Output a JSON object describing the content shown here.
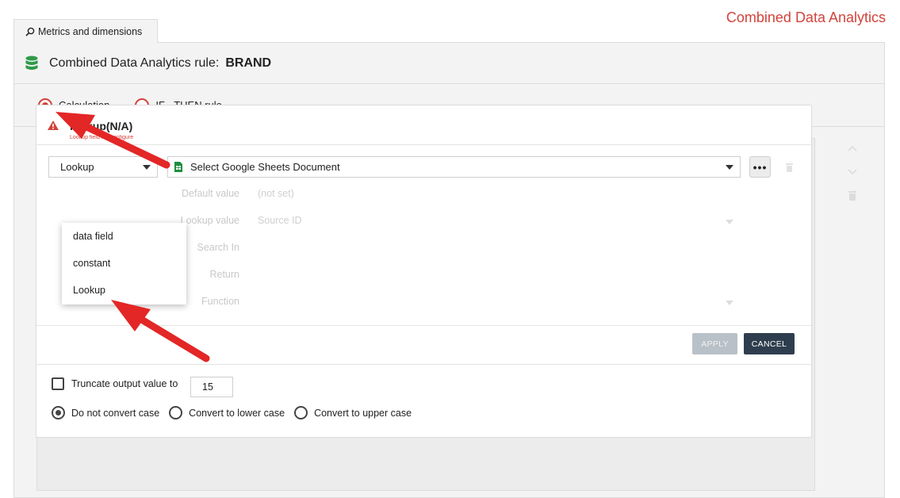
{
  "app_title": "Combined Data Analytics",
  "tab": {
    "label": "Metrics and dimensions",
    "icon": "search-icon"
  },
  "rule": {
    "label": "Combined Data Analytics rule:",
    "value": "BRAND"
  },
  "modes": [
    {
      "label": "Calculation",
      "selected": true
    },
    {
      "label": "IF - THEN rule",
      "selected": false
    }
  ],
  "card": {
    "title": "lookup(N/A)",
    "error": "Lookup field not configured",
    "type_select": {
      "value": "Lookup"
    },
    "doc_select": {
      "value": "Select Google Sheets Document"
    },
    "more_label": "•••",
    "fields": [
      {
        "label": "Default value",
        "value": "(not set)"
      },
      {
        "label": "Lookup value",
        "value": "Source ID"
      },
      {
        "label": "Search In",
        "value": ""
      },
      {
        "label": "Return",
        "value": ""
      },
      {
        "label": "Function",
        "value": ""
      }
    ],
    "dropdown_options": [
      "data field",
      "constant",
      "Lookup"
    ],
    "apply_label": "APPLY",
    "cancel_label": "CANCEL"
  },
  "truncate": {
    "label": "Truncate output value to",
    "value": "15",
    "checked": false
  },
  "case_options": [
    {
      "label": "Do not convert case",
      "selected": true
    },
    {
      "label": "Convert to lower case",
      "selected": false
    },
    {
      "label": "Convert to upper case",
      "selected": false
    }
  ],
  "colors": {
    "accent": "#d2433b",
    "dark_button": "#2f3e4e",
    "sheets_green": "#1e8e3e"
  }
}
